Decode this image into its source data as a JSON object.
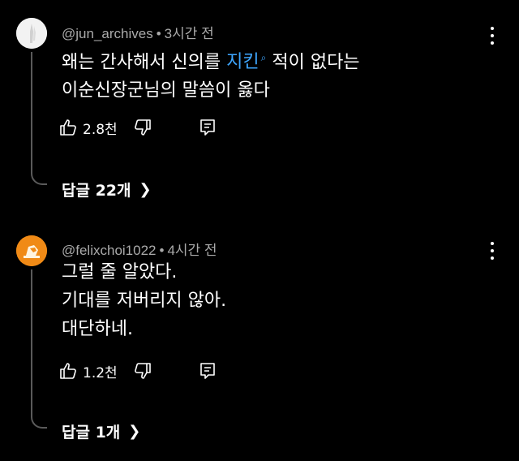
{
  "comments": [
    {
      "author": "@jun_archives",
      "time": "3시간 전",
      "body_lines": [
        {
          "before": "왜는 간사해서 신의를 ",
          "link": "지킨",
          "after": " 적이 없다는"
        },
        {
          "text": "이순신장군님의 말씀이 옳다"
        }
      ],
      "likes": "2.8천",
      "replies_label": "답글 22개"
    },
    {
      "author": "@felixchoi1022",
      "time": "4시간 전",
      "body_lines": [
        {
          "text": "그럴 줄 알았다."
        },
        {
          "text": "기대를 저버리지 않아."
        },
        {
          "text": "대단하네."
        }
      ],
      "likes": "1.2천",
      "replies_label": "답글 1개"
    }
  ],
  "separator": "•",
  "icons": {
    "like": "thumbs-up-icon",
    "dislike": "thumbs-down-icon",
    "reply": "reply-icon",
    "more": "more-vertical-icon",
    "expand": "chevron-right-icon",
    "link_search": "search-icon"
  },
  "colors": {
    "background": "#000000",
    "text": "#ffffff",
    "meta": "#aaaaaa",
    "link": "#3ea6ff",
    "avatar_2": "#f08a16"
  }
}
